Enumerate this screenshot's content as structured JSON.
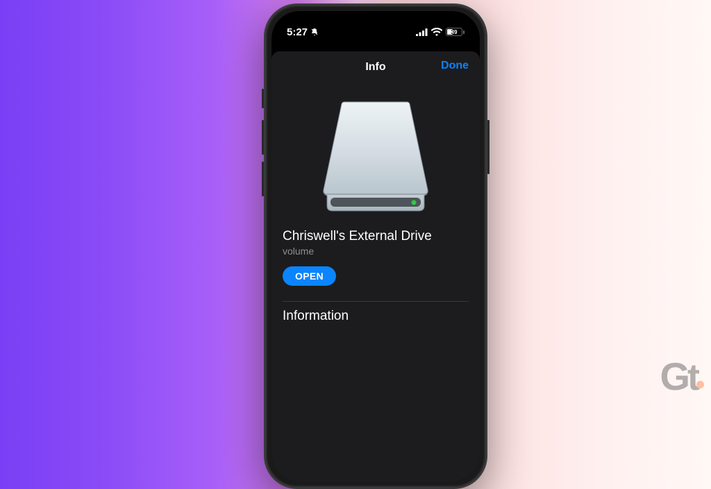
{
  "status_bar": {
    "time": "5:27",
    "battery_percent": "39"
  },
  "sheet": {
    "title": "Info",
    "done_label": "Done"
  },
  "drive": {
    "name": "Chriswell's External Drive",
    "kind": "volume",
    "open_label": "OPEN"
  },
  "sections": {
    "information_header": "Information"
  },
  "watermark": {
    "g": "G",
    "t": "t"
  }
}
